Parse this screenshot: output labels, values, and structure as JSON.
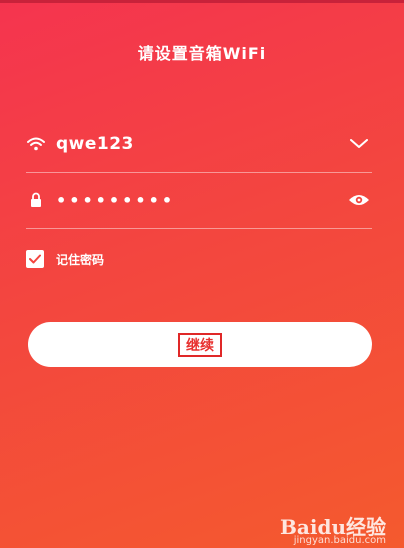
{
  "header": {
    "title": "请设置音箱WiFi"
  },
  "wifi": {
    "ssid": "qwe123",
    "ssid_icon": "wifi-icon",
    "dropdown_icon": "chevron-down-icon"
  },
  "password": {
    "masked_value": "•••••••••",
    "lock_icon": "lock-icon",
    "toggle_icon": "eye-icon"
  },
  "remember": {
    "label": "记住密码",
    "checked": true
  },
  "actions": {
    "continue_label": "继续"
  },
  "watermark": {
    "text": "Baidu经验",
    "sub": "jingyan.baidu.com"
  },
  "colors": {
    "bg_top": "#f5344f",
    "bg_bottom": "#f45a2e",
    "accent": "#e8302e"
  }
}
